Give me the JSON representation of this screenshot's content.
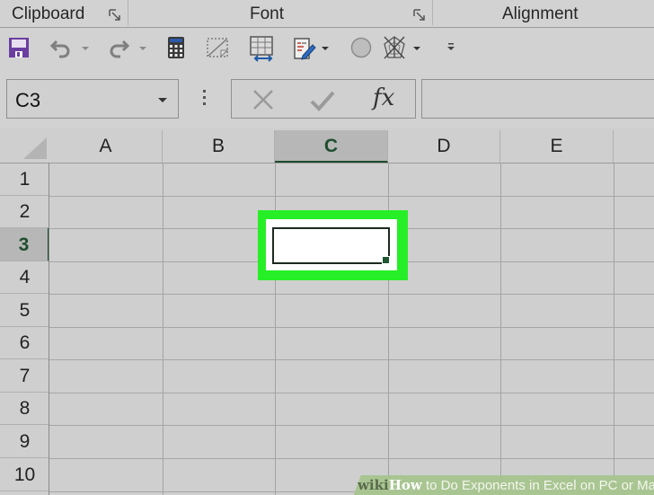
{
  "ribbon": {
    "groups": [
      {
        "label": "Clipboard"
      },
      {
        "label": "Font"
      },
      {
        "label": "Alignment"
      }
    ]
  },
  "quick_access_toolbar": {
    "icons": [
      "save-icon",
      "undo-icon",
      "redo-icon",
      "calculator-icon",
      "page-break-icon",
      "table-resize-icon",
      "edit-form-icon",
      "circle-shape-icon",
      "radar-chart-icon",
      "customize-toolbar-icon"
    ],
    "save_color": "#6b3fa0"
  },
  "formula_bar": {
    "name_box_value": "C3",
    "cancel_symbol": "✕",
    "enter_symbol": "✔",
    "fx_label": "fx",
    "formula_value": ""
  },
  "sheet": {
    "columns": [
      "A",
      "B",
      "C",
      "D",
      "E"
    ],
    "rows": [
      "1",
      "2",
      "3",
      "4",
      "5",
      "6",
      "7",
      "8",
      "9",
      "10"
    ],
    "selected_cell": "C3",
    "selected_column": "C",
    "selected_row": "3",
    "highlight_color": "#27ef27",
    "selection_color": "#1e5630"
  },
  "watermark": {
    "brand_wiki": "wiki",
    "brand_how": "How",
    "title": " to Do Exponents in Excel on PC or Mac"
  }
}
